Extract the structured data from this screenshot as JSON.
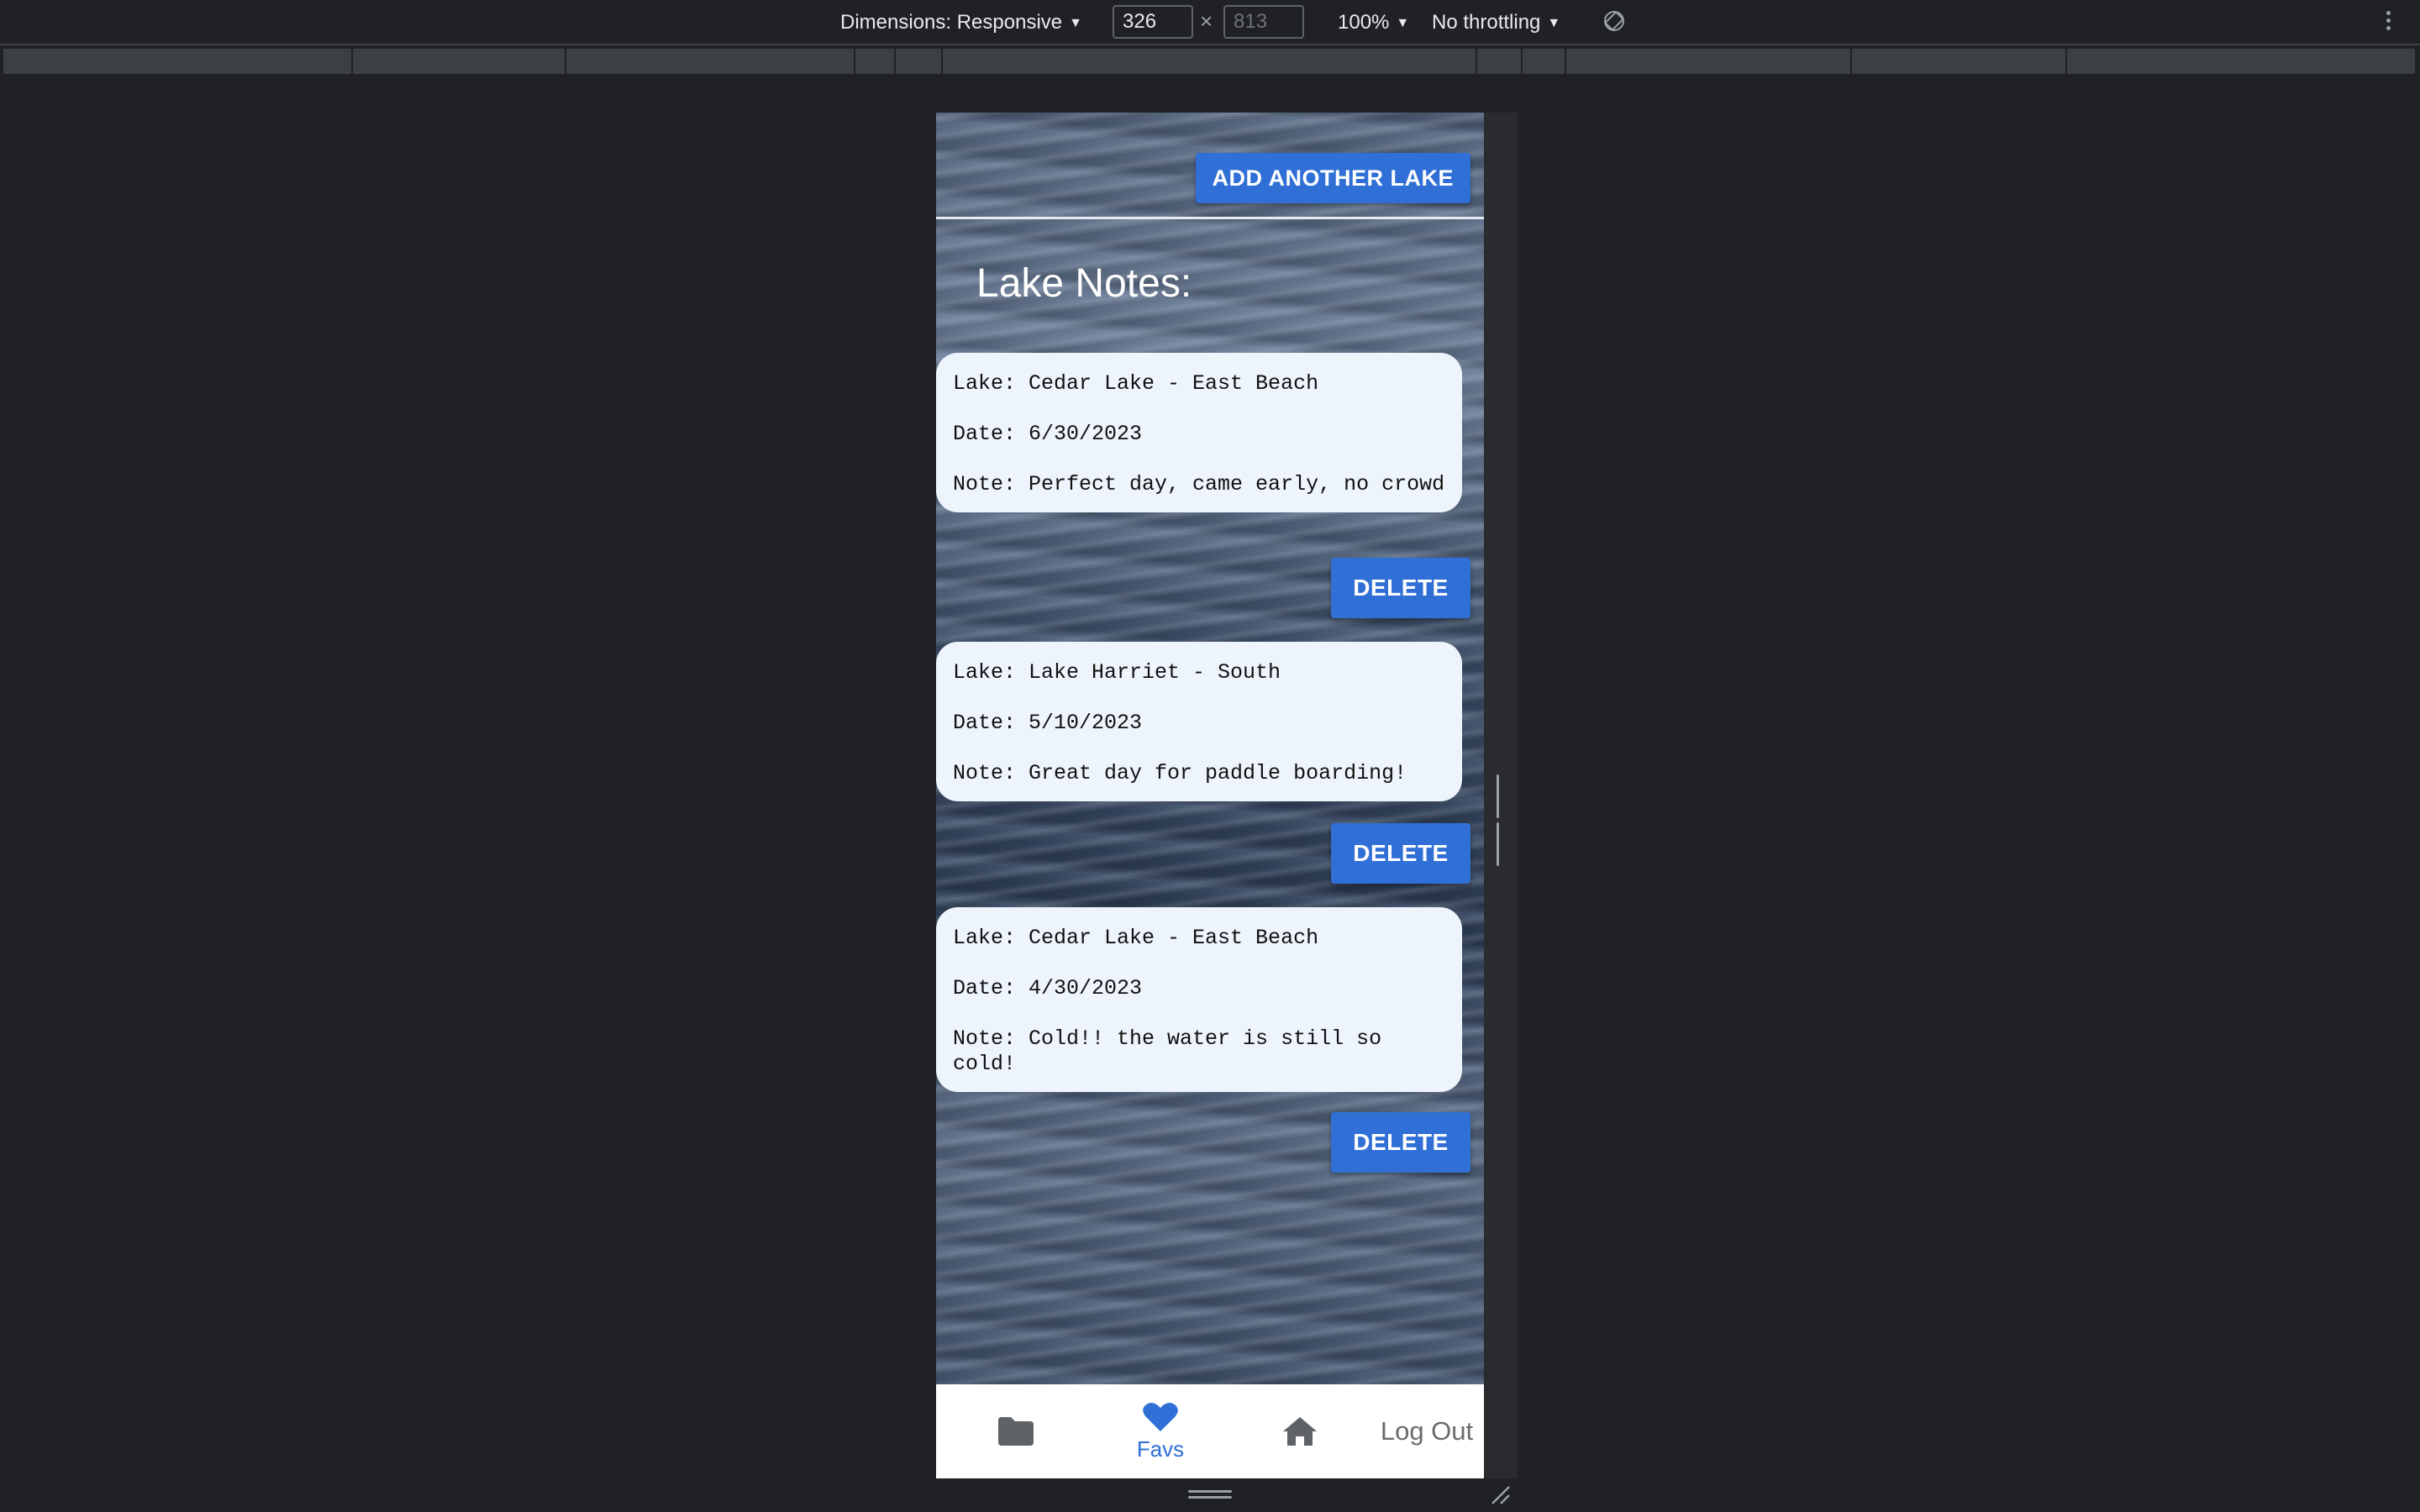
{
  "devtools": {
    "dimensions_label": "Dimensions: Responsive",
    "width_value": "326",
    "height_value": "813",
    "times_symbol": "×",
    "zoom_label": "100%",
    "throttling_label": "No throttling",
    "caret": "▼"
  },
  "app": {
    "add_button_label": "ADD ANOTHER LAKE",
    "page_title": "Lake Notes:",
    "delete_label": "DELETE",
    "notes": [
      {
        "lake": "Lake: Cedar Lake - East Beach",
        "date": "Date: 6/30/2023",
        "note": "Note: Perfect day, came early, no crowd"
      },
      {
        "lake": "Lake: Lake Harriet - South",
        "date": "Date: 5/10/2023",
        "note": "Note: Great day for paddle boarding!"
      },
      {
        "lake": "Lake: Cedar Lake - East Beach",
        "date": "Date: 4/30/2023",
        "note": "Note: Cold!! the water is still so cold!"
      }
    ],
    "nav": {
      "items": [
        {
          "icon": "folder-icon"
        },
        {
          "icon": "heart-icon",
          "label": "Favs",
          "active": true
        },
        {
          "icon": "home-icon"
        },
        {
          "label": "Log Out"
        }
      ]
    }
  },
  "colors": {
    "accent": "#2f6fd6",
    "card_bg": "#eef4fc",
    "devtools_bg": "#202124",
    "nav_icon": "#5f6368"
  }
}
